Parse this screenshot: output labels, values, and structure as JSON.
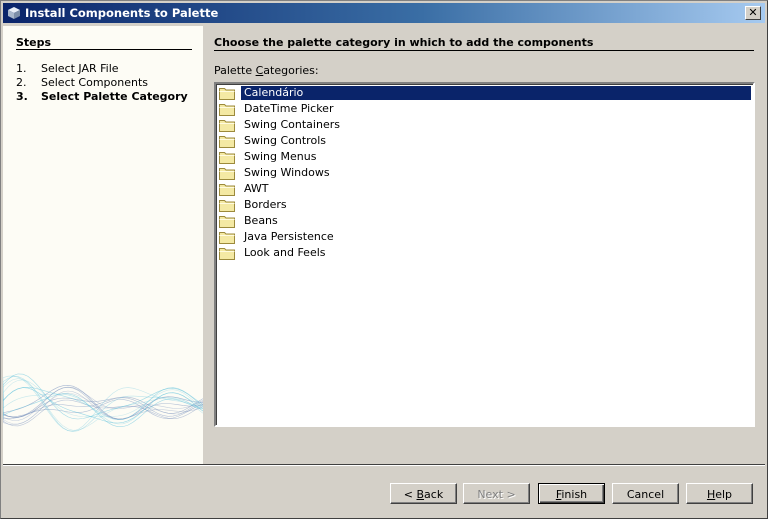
{
  "window": {
    "title": "Install Components to Palette",
    "close_label": "✕"
  },
  "sidebar": {
    "title": "Steps",
    "steps": [
      {
        "num": "1.",
        "label": "Select JAR File",
        "current": false
      },
      {
        "num": "2.",
        "label": "Select Components",
        "current": false
      },
      {
        "num": "3.",
        "label": "Select Palette Category",
        "current": true
      }
    ]
  },
  "main": {
    "title": "Choose the palette category in which to add the components",
    "list_label_pre": "Palette ",
    "list_label_mnemonic": "C",
    "list_label_post": "ategories:",
    "categories": [
      {
        "label": "Calendário",
        "selected": true,
        "icon": "folder-icon"
      },
      {
        "label": "DateTime Picker",
        "selected": false,
        "icon": "folder-icon"
      },
      {
        "label": "Swing Containers",
        "selected": false,
        "icon": "folder-icon"
      },
      {
        "label": "Swing Controls",
        "selected": false,
        "icon": "folder-icon"
      },
      {
        "label": "Swing Menus",
        "selected": false,
        "icon": "folder-icon"
      },
      {
        "label": "Swing Windows",
        "selected": false,
        "icon": "folder-icon"
      },
      {
        "label": "AWT",
        "selected": false,
        "icon": "folder-icon"
      },
      {
        "label": "Borders",
        "selected": false,
        "icon": "folder-icon"
      },
      {
        "label": "Beans",
        "selected": false,
        "icon": "folder-icon"
      },
      {
        "label": "Java Persistence",
        "selected": false,
        "icon": "folder-icon"
      },
      {
        "label": "Look and Feels",
        "selected": false,
        "icon": "folder-icon"
      }
    ]
  },
  "buttons": {
    "back": {
      "pre": "< ",
      "mnemonic": "B",
      "post": "ack"
    },
    "next": {
      "label": "Next >"
    },
    "finish": {
      "pre": "",
      "mnemonic": "F",
      "post": "inish"
    },
    "cancel": {
      "label": "Cancel"
    },
    "help": {
      "pre": "",
      "mnemonic": "H",
      "post": "elp"
    }
  },
  "colors": {
    "selection": "#0a246a",
    "dialog_bg": "#d4d0c8",
    "sidebar_bg": "#fdfcf5"
  }
}
